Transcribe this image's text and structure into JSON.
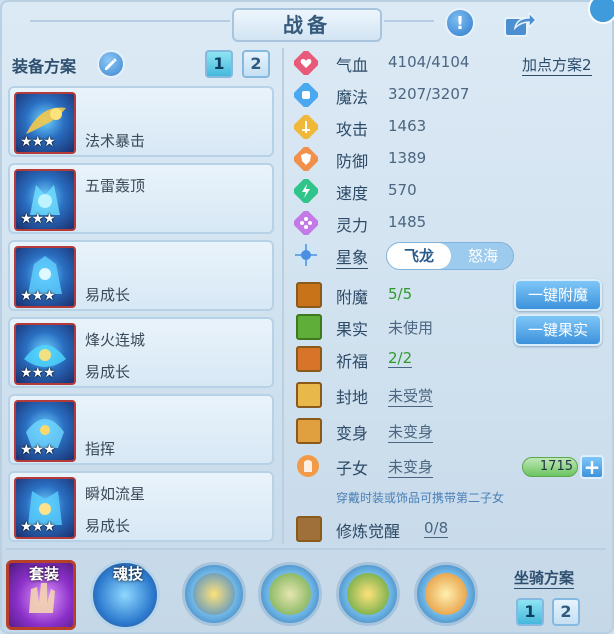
{
  "title": "战备",
  "equipment_plan": {
    "label": "装备方案",
    "plans": [
      "1",
      "2"
    ],
    "active_plan": "1"
  },
  "slots": [
    {
      "top": "",
      "mid": "法术暴击",
      "stars": "★★★"
    },
    {
      "top": "五雷轰顶",
      "mid": "",
      "stars": "★★★"
    },
    {
      "top": "",
      "mid": "易成长",
      "stars": "★★★"
    },
    {
      "top": "烽火连城",
      "mid": "易成长",
      "stars": "★★★"
    },
    {
      "top": "",
      "mid": "指挥",
      "stars": "★★★"
    },
    {
      "top": "瞬如流星",
      "mid": "易成长",
      "stars": "★★★"
    }
  ],
  "stats": [
    {
      "label": "气血",
      "value": "4104/4104",
      "icon": "heart-icon",
      "color": "#e95a7a"
    },
    {
      "label": "魔法",
      "value": "3207/3207",
      "icon": "mana-icon",
      "color": "#4aa8f0"
    },
    {
      "label": "攻击",
      "value": "1463",
      "icon": "sword-icon",
      "color": "#f0b838"
    },
    {
      "label": "防御",
      "value": "1389",
      "icon": "shield-icon",
      "color": "#f0904a"
    },
    {
      "label": "速度",
      "value": "570",
      "icon": "lightning-icon",
      "color": "#2fc58a"
    },
    {
      "label": "灵力",
      "value": "1485",
      "icon": "spirit-icon",
      "color": "#c47ae6"
    }
  ],
  "point_plan_link": "加点方案2",
  "xing_xiang": {
    "label": "星象",
    "options": [
      "飞龙",
      "怒海"
    ],
    "active": "飞龙"
  },
  "extras": [
    {
      "label": "附魔",
      "value": "5/5",
      "green": true
    },
    {
      "label": "果实",
      "value": "未使用",
      "green": false
    },
    {
      "label": "祈福",
      "value": "2/2",
      "green": true
    },
    {
      "label": "封地",
      "value": "未受赏",
      "green": false
    },
    {
      "label": "变身",
      "value": "未变身",
      "green": false
    },
    {
      "label": "子女",
      "value": "未变身",
      "green": false
    }
  ],
  "buttons": {
    "one_click_enchant": "一键附魔",
    "one_click_fruit": "一键果实"
  },
  "coin_value": "1715",
  "hint": "穿戴时装或饰品可携带第二子女",
  "cultivation": {
    "label": "修炼觉醒",
    "value": "0/8"
  },
  "bottom": {
    "suit_label": "套装",
    "soul_skill_label": "魂技",
    "mount_plan_label": "坐骑方案",
    "mount_plans": [
      "1",
      "2"
    ]
  }
}
